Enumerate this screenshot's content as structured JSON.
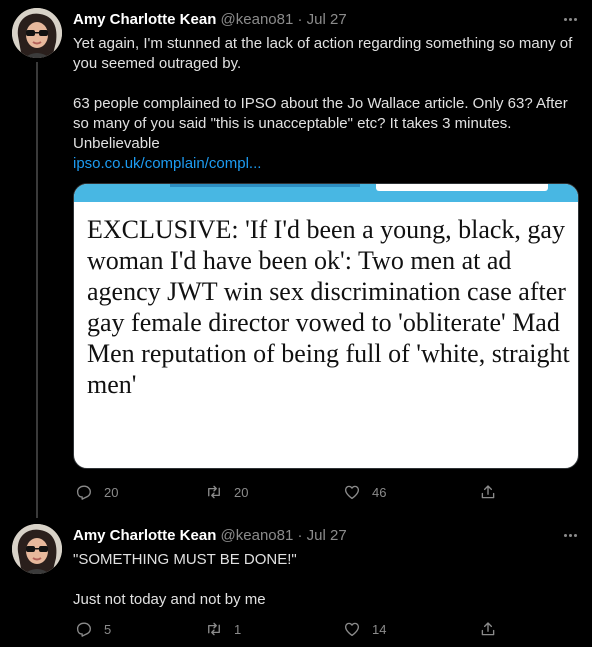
{
  "tweets": [
    {
      "author_name": "Amy Charlotte Kean",
      "meta": "@keano81 · Jul 27",
      "paragraph1": "Yet again, I'm stunned at the lack of action regarding something so many of you seemed outraged by.",
      "paragraph2": "63 people complained to IPSO about the Jo Wallace article. Only 63? After so many of you said \"this is unacceptable\" etc? It takes 3 minutes. Unbelievable",
      "link": "ipso.co.uk/complain/compl...",
      "card_headline": "EXCLUSIVE: 'If I'd been a young, black, gay woman I'd have been ok': Two men at ad agency JWT win sex discrimination case after gay female director vowed to 'obliterate' Mad Men reputation of being full of 'white, straight men'",
      "replies": "20",
      "retweets": "20",
      "likes": "46"
    },
    {
      "author_name": "Amy Charlotte Kean",
      "meta": "@keano81 · Jul 27",
      "paragraph1": "\"SOMETHING MUST BE DONE!\"",
      "paragraph2": "Just not today and not by me",
      "replies": "5",
      "retweets": "1",
      "likes": "14"
    }
  ],
  "icons": {
    "reply": "reply-icon",
    "retweet": "retweet-icon",
    "like": "heart-icon",
    "share": "share-icon",
    "more": "more-icon"
  },
  "colors": {
    "background": "#000000",
    "link": "#1d9bf0",
    "secondary_text": "#8b8b8b"
  }
}
